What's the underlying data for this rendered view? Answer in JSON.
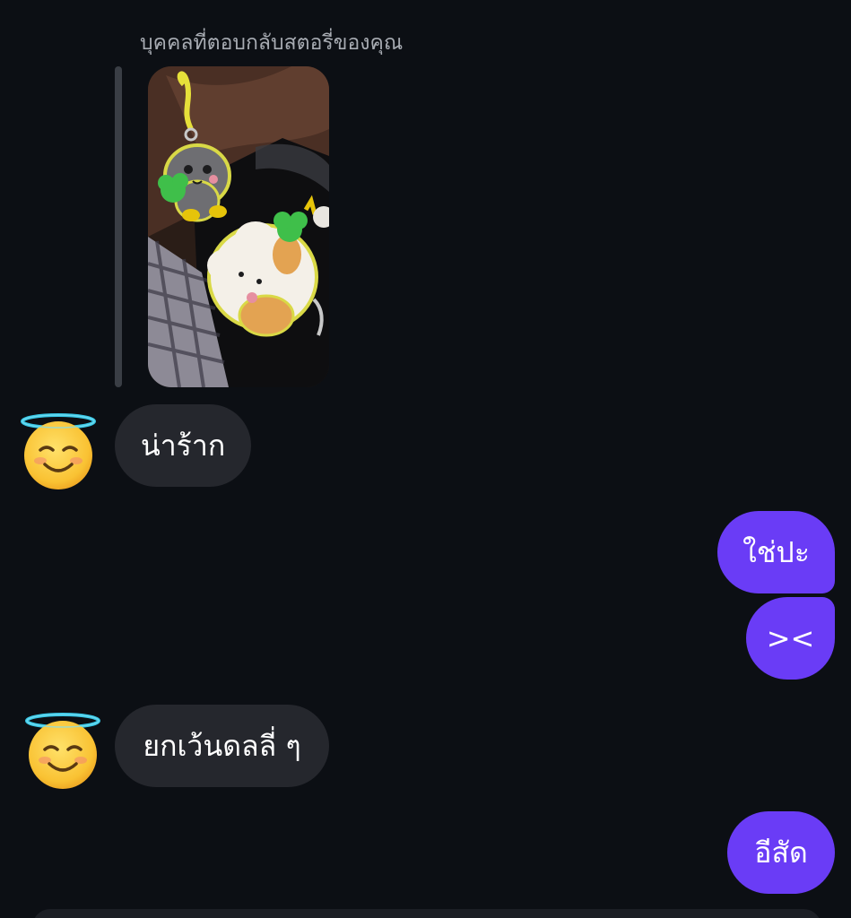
{
  "thread": {
    "story_reply_caption": "บุคคลที่ตอบกลับสตอรี่ของคุณ",
    "messages": [
      {
        "sender": "them",
        "text": "น่าร้าก"
      },
      {
        "sender": "me",
        "text": "ใช่ปะ"
      },
      {
        "sender": "me",
        "text": "><"
      },
      {
        "sender": "them",
        "text": "ยกเว้นดลลี่ ๆ"
      },
      {
        "sender": "me",
        "text": "อีสัด"
      }
    ]
  },
  "avatar": {
    "icon": "smiling-face-with-halo-icon"
  },
  "colors": {
    "background": "#0c0f14",
    "incoming_bubble": "#25272d",
    "outgoing_bubble": "#6a3cf6",
    "caption_text": "#a7abb2"
  }
}
